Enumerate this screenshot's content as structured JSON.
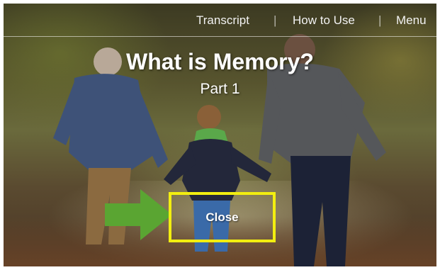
{
  "nav": {
    "transcript": "Transcript",
    "how_to_use": "How to Use",
    "menu": "Menu",
    "separator": "|"
  },
  "title": "What is Memory?",
  "subtitle": "Part 1",
  "close_label": "Close",
  "colors": {
    "highlight_box": "#f2ee10",
    "arrow": "#5aa532",
    "text": "#ffffff"
  }
}
